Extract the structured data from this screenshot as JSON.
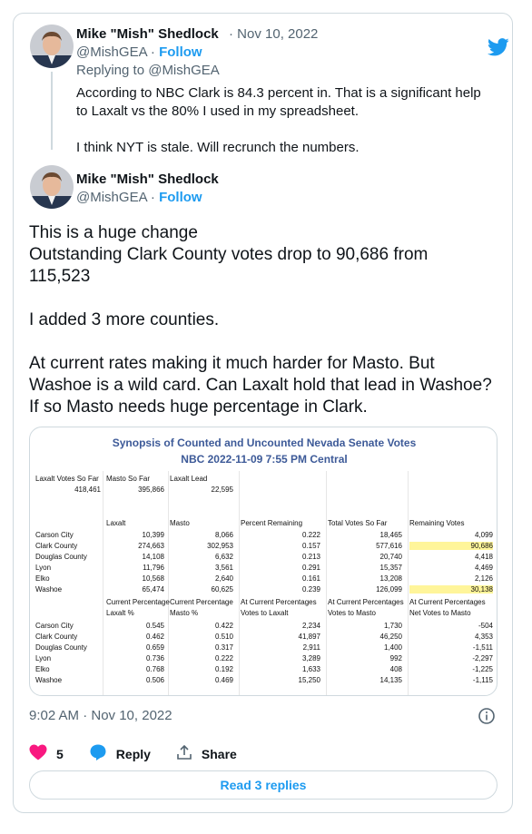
{
  "tweet_parent": {
    "author_name": "Mike \"Mish\" Shedlock",
    "date": "· Nov 10, 2022",
    "handle": "@MishGEA",
    "follow_label": "Follow",
    "replying_to": "Replying to @MishGEA",
    "text_p1": "According to NBC Clark is 84.3 percent in. That is a significant help to Laxalt vs the 80% I used in my spreadsheet.",
    "text_p2": "I think NYT is stale. Will recrunch the numbers."
  },
  "tweet_main": {
    "author_name": "Mike \"Mish\" Shedlock",
    "handle": "@MishGEA",
    "follow_label": "Follow",
    "text_line1": "This is a huge change",
    "text_line2": "Outstanding Clark County votes drop to 90,686 from 115,523",
    "text_p2": "I added 3 more counties.",
    "text_p3": "At current rates making it much harder for Masto. But Washoe is a wild card. Can Laxalt hold that lead in Washoe? If so Masto needs huge percentage in Clark.",
    "timestamp": "9:02 AM · Nov 10, 2022",
    "like_count": "5",
    "reply_label": "Reply",
    "share_label": "Share",
    "read_replies_label": "Read 3 replies"
  },
  "spreadsheet": {
    "title": "Synopsis of Counted and Uncounted Nevada Senate Votes",
    "subtitle": "NBC 2022-11-09 7:55 PM Central",
    "summary_headers": [
      "Laxalt Votes So Far",
      "Masto So Far",
      "Laxalt Lead"
    ],
    "summary_values": [
      "418,461",
      "395,866",
      "22,595"
    ],
    "table1_headers": [
      "",
      "Laxalt",
      "Masto",
      "Percent Remaining",
      "Total Votes So Far",
      "Remaining Votes"
    ],
    "table1_rows": [
      [
        "Carson City",
        "10,399",
        "8,066",
        "0.222",
        "18,465",
        "4,099"
      ],
      [
        "Clark County",
        "274,663",
        "302,953",
        "0.157",
        "577,616",
        "90,686"
      ],
      [
        "Douglas County",
        "14,108",
        "6,632",
        "0.213",
        "20,740",
        "4,418"
      ],
      [
        "Lyon",
        "11,796",
        "3,561",
        "0.291",
        "15,357",
        "4,469"
      ],
      [
        "Elko",
        "10,568",
        "2,640",
        "0.161",
        "13,208",
        "2,126"
      ],
      [
        "Washoe",
        "65,474",
        "60,625",
        "0.239",
        "126,099",
        "30,138"
      ]
    ],
    "table2_headers_top": [
      "",
      "Current Percentage",
      "Current Percentage",
      "At Current Percentages",
      "At Current Percentages",
      "At Current Percentages"
    ],
    "table2_headers_bottom": [
      "",
      "Laxalt %",
      "Masto %",
      "Votes to Laxalt",
      "Votes to Masto",
      "Net Votes to Masto"
    ],
    "table2_rows": [
      [
        "Carson City",
        "0.545",
        "0.422",
        "2,234",
        "1,730",
        "-504"
      ],
      [
        "Clark County",
        "0.462",
        "0.510",
        "41,897",
        "46,250",
        "4,353"
      ],
      [
        "Douglas County",
        "0.659",
        "0.317",
        "2,911",
        "1,400",
        "-1,511"
      ],
      [
        "Lyon",
        "0.736",
        "0.222",
        "3,289",
        "992",
        "-2,297"
      ],
      [
        "Elko",
        "0.768",
        "0.192",
        "1,633",
        "408",
        "-1,225"
      ],
      [
        "Washoe",
        "0.506",
        "0.469",
        "15,250",
        "14,135",
        "-1,115"
      ]
    ]
  },
  "colors": {
    "accent": "#1d9bf0",
    "like": "#f91880",
    "highlight": "#fff59a",
    "sheet_title": "#3d5a98"
  },
  "icons": [
    "twitter-bird-icon",
    "heart-icon",
    "reply-bubble-icon",
    "share-icon",
    "info-icon"
  ]
}
